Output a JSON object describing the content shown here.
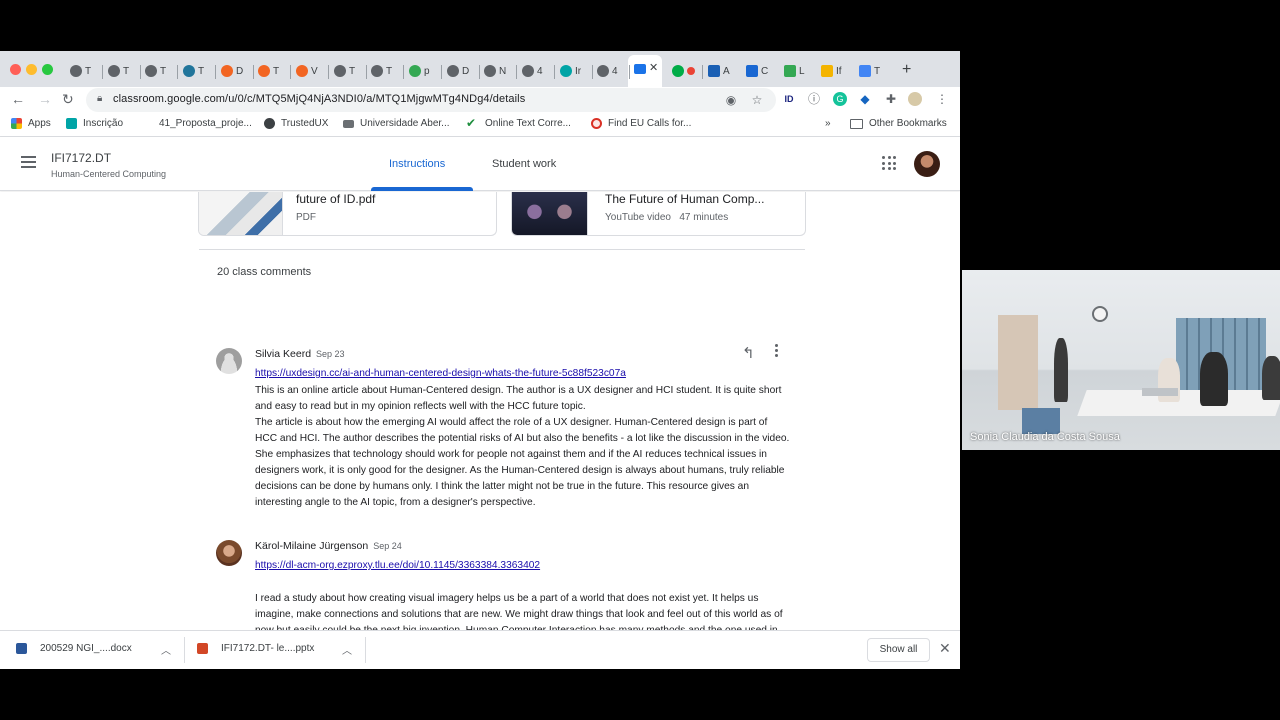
{
  "browser": {
    "tabs": [
      {
        "label": "T",
        "color": "#5f6368"
      },
      {
        "label": "T",
        "color": "#5f6368"
      },
      {
        "label": "T",
        "color": "#5f6368"
      },
      {
        "label": "T",
        "color": "#21759b"
      },
      {
        "label": "D",
        "color": "#f26522"
      },
      {
        "label": "T",
        "color": "#f26522"
      },
      {
        "label": "V",
        "color": "#f26522"
      },
      {
        "label": "T",
        "color": "#5f6368"
      },
      {
        "label": "T",
        "color": "#5f6368"
      },
      {
        "label": "p",
        "color": "#34a853"
      },
      {
        "label": "D",
        "color": "#5f6368"
      },
      {
        "label": "N",
        "color": "#5f6368"
      },
      {
        "label": "4",
        "color": "#5f6368"
      },
      {
        "label": "Ir",
        "color": "#00a4a6"
      },
      {
        "label": "4",
        "color": "#5f6368"
      }
    ],
    "tabs_right": [
      {
        "label": "A",
        "color": "#1a5fb4"
      },
      {
        "label": "C",
        "color": "#1967d2"
      },
      {
        "label": "L",
        "color": "#34a853"
      },
      {
        "label": "If",
        "color": "#f4b400"
      },
      {
        "label": "T",
        "color": "#4285f4"
      }
    ],
    "url": "classroom.google.com/u/0/c/MTQ5MjQ4NjA3NDI0/a/MTQ1MjgwMTg4NDg4/details",
    "bookmarks": {
      "apps": "Apps",
      "items": [
        "Inscrição",
        "41_Proposta_proje...",
        "TrustedUX",
        "Universidade Aber...",
        "Online Text Corre...",
        "Find EU Calls for..."
      ],
      "overflow": "»",
      "other": "Other Bookmarks"
    }
  },
  "classroom": {
    "class_title": "IFI7172.DT",
    "class_subtitle": "Human-Centered Computing",
    "tabs": [
      "Instructions",
      "Student work"
    ],
    "accent": "#1967d2"
  },
  "attachments": [
    {
      "title": "future of ID.pdf",
      "subtitle": "PDF"
    },
    {
      "title": "The Future of Human Comp...",
      "subtitle": "YouTube video   47 minutes"
    }
  ],
  "comments_count": "20 class comments",
  "comments": [
    {
      "author": "Silvia Keerd",
      "date": "Sep 23",
      "link": "https://uxdesign.cc/ai-and-human-centered-design-whats-the-future-5c88f523c07a",
      "paragraphs": [
        "This is an online article about Human-Centered design. The author is a UX designer and HCI student. It is quite short and easy to read but in my opinion reflects well with the HCC future topic.",
        "The article is about how the emerging AI would affect the role of a UX designer. Human-Centered design is part of HCC and HCI. The author describes the potential risks of AI but also the benefits - a lot like the discussion in the video. She emphasizes  that technology should work for people not against them and if the AI reduces technical issues in designers work, it is only good for the designer. As the Human-Centered design is always about humans, truly reliable decisions can be done by humans only. I think the latter might not be true in the future. This resource gives an interesting angle to the AI topic, from a designer's perspective."
      ]
    },
    {
      "author": "Kärol-Milaine Jürgenson",
      "date": "Sep 24",
      "link": "https://dl-acm-org.ezproxy.tlu.ee/doi/10.1145/3363384.3363402",
      "paragraphs": [
        "I read a study about how creating visual imagery helps us be a part of a world that does not exist yet. It helps us imagine, make connections and solutions that are new. We might draw things that look and feel out of this world as of now but easily could be the next big invention. Human Computer Interaction has many methods and the one used in this study categorizes under “offline” creative arts. It also connects with Human-Centered Computing by being a big part in the design process."
      ]
    }
  ],
  "downloads": {
    "items": [
      "200529 NGI_....docx",
      "IFI7172.DT- le....pptx"
    ],
    "show_all": "Show all"
  },
  "video": {
    "participant": "Sonia Claudia da Costa Sousa"
  },
  "icons": {
    "reply": "reply-icon",
    "more": "more-vert-icon",
    "help": "help-icon"
  }
}
